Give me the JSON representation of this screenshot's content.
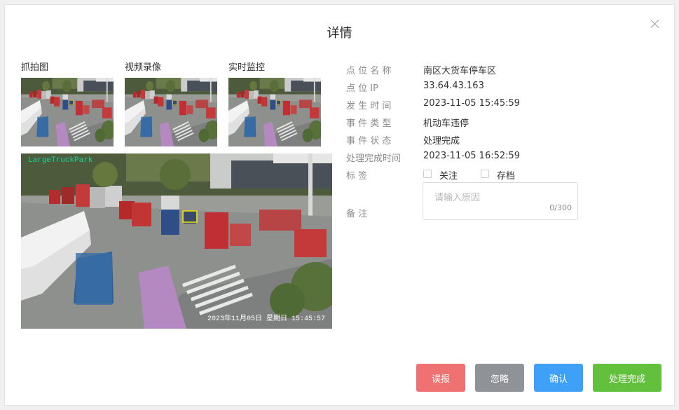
{
  "dialog": {
    "title": "详情"
  },
  "media": {
    "thumbs": [
      {
        "label": "抓拍图"
      },
      {
        "label": "视频录像"
      },
      {
        "label": "实时监控"
      }
    ],
    "main_overlay_text": "LargeTruckPark",
    "main_timestamp": "2023年11月05日 星期日 15:45:57"
  },
  "info": {
    "point_name": {
      "label": "点 位 名 称",
      "value": "南区大货车停车区"
    },
    "point_ip": {
      "label": "点 位 IP",
      "value": "33.64.43.163"
    },
    "time": {
      "label": "发 生 时 间",
      "value": "2023-11-05 15:45:59"
    },
    "type": {
      "label": "事 件 类 型",
      "value": "机动车违停"
    },
    "status": {
      "label": "事 件 状 态",
      "value": "处理完成"
    },
    "done_time": {
      "label": "处理完成时间",
      "value": "2023-11-05 16:52:59"
    },
    "tags": {
      "label": "标 签",
      "options": [
        "关注",
        "存档"
      ]
    },
    "remark": {
      "label": "备 注",
      "placeholder": "请输入原因",
      "counter": "0/300"
    }
  },
  "buttons": {
    "false_report": "误报",
    "ignore": "忽略",
    "confirm": "确认",
    "complete": "处理完成"
  },
  "colors": {
    "false_report": "#f07171",
    "ignore": "#8f9398",
    "confirm": "#3fa0f7",
    "complete": "#63c03d"
  }
}
